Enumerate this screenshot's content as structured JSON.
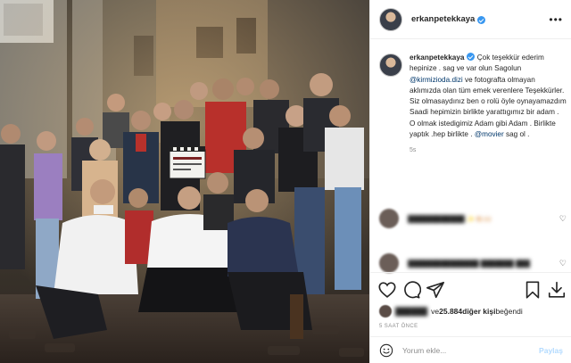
{
  "post": {
    "username": "erkanpetekkaya",
    "more_icon": "more-horizontal-icon",
    "photo_alt": "Film crew group photo at night with clapperboard"
  },
  "caption": {
    "username": "erkanpetekkaya",
    "part1": " Çok teşekkür ederim hepinize . sag ve var olun Sagolun ",
    "mention1": "@kirmizioda.dizi",
    "part2": " ve fotografta olmayan aklımızda olan tüm emek verenlere Teşekkürler. Siz olmasaydınız ben o rolü öyle oynayamazdım Saadi hepimizin birlikte yarattıgımız bir adam . O olmak istedigimiz Adam gibi Adam . Birlikte yaptık .hep birlikte . ",
    "mention2": "@movier",
    "part3": " sag ol .",
    "time": "5s"
  },
  "comments": [
    {
      "text": "████████████ ✨👏🏻🙌🏻"
    },
    {
      "text": "███████████████ ███████ ███"
    }
  ],
  "actions": {
    "icons": [
      "heart-icon",
      "comment-icon",
      "share-icon",
      "bookmark-icon",
      "download-icon"
    ],
    "likes_prefix": " ve ",
    "likes_count": "25.884",
    "likes_suffix": " diğer kişi",
    "likes_end": " beğendi",
    "blurred_name": "██████",
    "time_ago": "5 SAAT ÖNCE"
  },
  "comment_box": {
    "placeholder": "Yorum ekle...",
    "post_label": "Paylaş"
  },
  "colors": {
    "verified": "#3897f0",
    "link": "#00376b",
    "post_btn": "#b3dbff"
  }
}
